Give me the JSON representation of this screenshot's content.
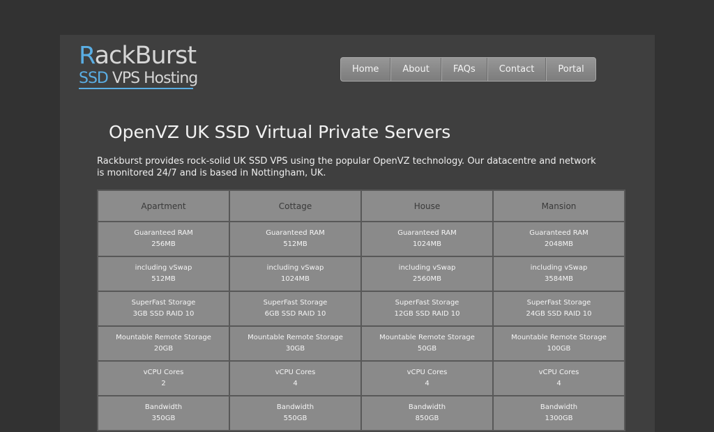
{
  "logo": {
    "line1_a": "R",
    "line1_b": "ackBurst",
    "line2_a": "SSD",
    "line2_b": " VPS Hosting"
  },
  "nav": {
    "items": [
      "Home",
      "About",
      "FAQs",
      "Contact",
      "Portal"
    ]
  },
  "page": {
    "title": "OpenVZ UK SSD Virtual Private Servers",
    "intro": "Rackburst provides rock-solid UK SSD VPS using the popular OpenVZ technology. Our datacentre and network is monitored 24/7 and is based in Nottingham, UK."
  },
  "plans": {
    "headers": [
      "Apartment",
      "Cottage",
      "House",
      "Mansion"
    ],
    "rows": [
      [
        {
          "label": "Guaranteed RAM",
          "value": "256MB"
        },
        {
          "label": "Guaranteed RAM",
          "value": "512MB"
        },
        {
          "label": "Guaranteed RAM",
          "value": "1024MB"
        },
        {
          "label": "Guaranteed RAM",
          "value": "2048MB"
        }
      ],
      [
        {
          "label": "including vSwap",
          "value": "512MB"
        },
        {
          "label": "including vSwap",
          "value": "1024MB"
        },
        {
          "label": "including vSwap",
          "value": "2560MB"
        },
        {
          "label": "including vSwap",
          "value": "3584MB"
        }
      ],
      [
        {
          "label": "SuperFast Storage",
          "value": "3GB SSD RAID 10"
        },
        {
          "label": "SuperFast Storage",
          "value": "6GB SSD RAID 10"
        },
        {
          "label": "SuperFast Storage",
          "value": "12GB SSD RAID 10"
        },
        {
          "label": "SuperFast Storage",
          "value": "24GB SSD RAID 10"
        }
      ],
      [
        {
          "label": "Mountable Remote Storage",
          "value": "20GB"
        },
        {
          "label": "Mountable Remote Storage",
          "value": "30GB"
        },
        {
          "label": "Mountable Remote Storage",
          "value": "50GB"
        },
        {
          "label": "Mountable Remote Storage",
          "value": "100GB"
        }
      ],
      [
        {
          "label": "vCPU Cores",
          "value": "2"
        },
        {
          "label": "vCPU Cores",
          "value": "4"
        },
        {
          "label": "vCPU Cores",
          "value": "4"
        },
        {
          "label": "vCPU Cores",
          "value": "4"
        }
      ],
      [
        {
          "label": "Bandwidth",
          "value": "350GB"
        },
        {
          "label": "Bandwidth",
          "value": "550GB"
        },
        {
          "label": "Bandwidth",
          "value": "850GB"
        },
        {
          "label": "Bandwidth",
          "value": "1300GB"
        }
      ]
    ]
  },
  "colors": {
    "background": "#323232",
    "panel": "#3f3f3f",
    "accent_blue": "#5aaee4",
    "table_cell": "#8a8a8a",
    "table_border": "#585858"
  }
}
